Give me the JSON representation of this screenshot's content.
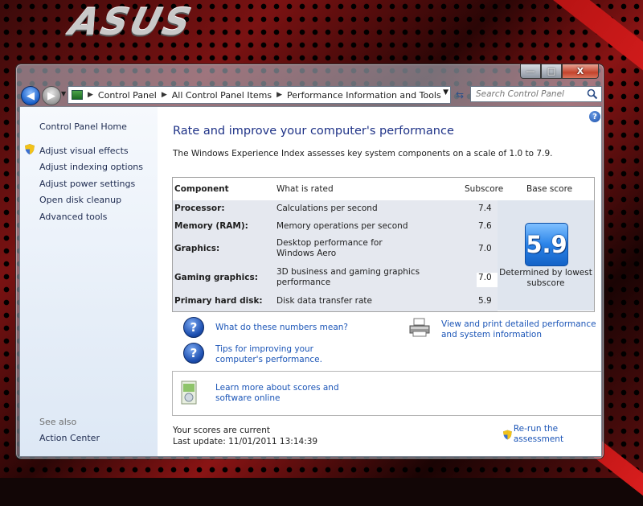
{
  "brand": {
    "logo_text": "ASUS"
  },
  "window": {
    "caption": {
      "minimize": "—",
      "maximize": "□",
      "close": "X"
    }
  },
  "nav": {
    "breadcrumbs": [
      "Control Panel",
      "All Control Panel Items",
      "Performance Information and Tools"
    ],
    "separator": "▶",
    "search_placeholder": "Search Control Panel"
  },
  "sidebar": {
    "home": "Control Panel Home",
    "items": [
      {
        "label": "Adjust visual effects",
        "icon": "shield-icon"
      },
      {
        "label": "Adjust indexing options"
      },
      {
        "label": "Adjust power settings"
      },
      {
        "label": "Open disk cleanup"
      },
      {
        "label": "Advanced tools"
      }
    ],
    "see_also": "See also",
    "see_also_items": [
      "Action Center"
    ]
  },
  "main": {
    "title": "Rate and improve your computer's performance",
    "intro": "The Windows Experience Index assesses key system components on a scale of 1.0 to 7.9.",
    "table": {
      "headers": [
        "Component",
        "What is rated",
        "Subscore",
        "Base score"
      ],
      "rows": [
        {
          "component": "Processor:",
          "rated": "Calculations per second",
          "subscore": "7.4"
        },
        {
          "component": "Memory (RAM):",
          "rated": "Memory operations per second",
          "subscore": "7.6"
        },
        {
          "component": "Graphics:",
          "rated": "Desktop performance for Windows Aero",
          "subscore": "7.0"
        },
        {
          "component": "Gaming graphics:",
          "rated": "3D business and gaming graphics performance",
          "subscore": "7.0"
        },
        {
          "component": "Primary hard disk:",
          "rated": "Disk data transfer rate",
          "subscore": "5.9"
        }
      ],
      "base_score": "5.9",
      "base_caption": "Determined by lowest subscore"
    },
    "links": {
      "what_numbers": "What do these numbers mean?",
      "tips": "Tips for improving your computer's performance.",
      "print": "View and print detailed performance and system information",
      "learn": "Learn more about scores and software online"
    },
    "status": {
      "current": "Your scores are current",
      "last_update": "Last update: 11/01/2011 13:14:39",
      "rerun": "Re-run the assessment"
    }
  },
  "colors": {
    "link": "#1b55b7",
    "title": "#1e3287",
    "badge": "#2a83e8"
  }
}
